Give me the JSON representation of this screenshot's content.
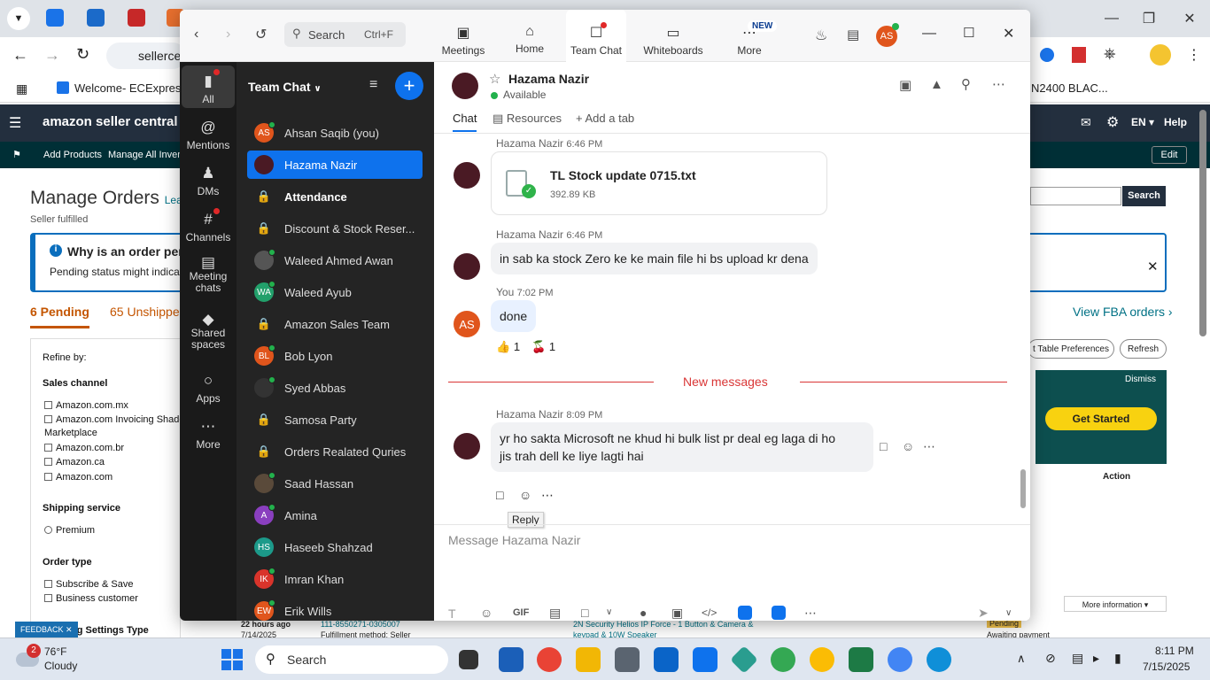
{
  "browser": {
    "address": "sellerce",
    "bookmark_welcome": "Welcome- ECExpres...",
    "bookmark_right": "N2400 BLAC..."
  },
  "amazon": {
    "brand": "amazon seller central",
    "lang": "EN",
    "help": "Help",
    "edit": "Edit",
    "add_products": "Add Products",
    "manage_inventory": "Manage All Invent",
    "page_title": "Manage Orders",
    "learn": "Lear",
    "subtitle": "Seller fulfilled",
    "info_title": "Why is an order pen",
    "info_body": "Pending status might indicate a",
    "tab_pending": "6 Pending",
    "tab_unshipped": "65 Unshipped",
    "search_btn": "Search",
    "view_fba": "View FBA orders",
    "table_prefs": "t Table Preferences",
    "refresh": "Refresh",
    "refine_by": "Refine by:",
    "sales_channel": "Sales channel",
    "channels": [
      "Amazon.com.mx",
      "Amazon.com Invoicing Shado",
      "Marketplace",
      "Amazon.com.br",
      "Amazon.ca",
      "Amazon.com"
    ],
    "shipping_service": "Shipping service",
    "premium": "Premium",
    "order_type": "Order type",
    "order_types": [
      "Subscribe & Save",
      "Business customer"
    ],
    "settings_type": "ng Settings Type",
    "feedback": "FEEDBACK",
    "dismiss": "Dismiss",
    "get_started": "Get Started",
    "action": "Action",
    "more_info": "More information",
    "row_time": "22 hours ago",
    "row_date": "7/14/2025",
    "row_order": "111-8550271-0305007",
    "row_fulfill": "Fulfillment method: Seller",
    "row_product": "2N Security Helios IP Force - 1 Button & Camera &",
    "row_product2": "keypad & 10W Speaker",
    "row_status": "Pending",
    "row_status2": "Awaiting payment"
  },
  "zoom": {
    "search_label": "Search",
    "search_shortcut": "Ctrl+F",
    "nav_tabs": [
      {
        "label": "Meetings"
      },
      {
        "label": "Home"
      },
      {
        "label": "Team Chat"
      },
      {
        "label": "Whiteboards"
      },
      {
        "label": "More"
      }
    ],
    "new_badge": "NEW",
    "user_initials": "AS",
    "rail": [
      {
        "label": "All"
      },
      {
        "label": "Mentions"
      },
      {
        "label": "DMs"
      },
      {
        "label": "Channels"
      },
      {
        "label": "Meeting chats"
      },
      {
        "label": "Shared spaces"
      },
      {
        "label": "Apps"
      },
      {
        "label": "More"
      }
    ],
    "list_title": "Team Chat",
    "chats": [
      {
        "name": "Ahsan Saqib (you)",
        "initials": "AS"
      },
      {
        "name": "Hazama Nazir",
        "initials": ""
      },
      {
        "name": "Attendance",
        "initials": ""
      },
      {
        "name": "Discount & Stock Reser...",
        "initials": ""
      },
      {
        "name": "Waleed Ahmed Awan",
        "initials": ""
      },
      {
        "name": "Waleed Ayub",
        "initials": "WA"
      },
      {
        "name": "Amazon Sales Team",
        "initials": ""
      },
      {
        "name": "Bob Lyon",
        "initials": "BL"
      },
      {
        "name": "Syed Abbas",
        "initials": ""
      },
      {
        "name": "Samosa Party",
        "initials": ""
      },
      {
        "name": "Orders Realated Quries",
        "initials": ""
      },
      {
        "name": "Saad Hassan",
        "initials": ""
      },
      {
        "name": "Amina",
        "initials": "A"
      },
      {
        "name": "Haseeb Shahzad",
        "initials": "HS"
      },
      {
        "name": "Imran Khan",
        "initials": "IK"
      },
      {
        "name": "Erik Wills",
        "initials": "EW"
      }
    ],
    "contact_name": "Hazama Nazir",
    "contact_status": "Available",
    "tabs": [
      "Chat",
      "Resources",
      "Add a tab"
    ],
    "messages": {
      "m1_sender": "Hazama Nazir",
      "m1_time": "6:46 PM",
      "file_name": "TL Stock update 0715.txt",
      "file_size": "392.89 KB",
      "m2_sender": "Hazama Nazir",
      "m2_time": "6:46 PM",
      "m2_text": "in sab ka stock Zero ke ke main file  hi bs upload kr dena",
      "m3_sender": "You",
      "m3_time": "7:02 PM",
      "m3_initials": "AS",
      "m3_text": "done",
      "reaction1_count": "1",
      "reaction2_count": "1",
      "new_messages": "New messages",
      "m4_sender": "Hazama Nazir",
      "m4_time": "8:09 PM",
      "m4_text_line1": "yr ho sakta Microsoft ne khud hi bulk list pr deal eg laga di ho",
      "m4_text_line2": "jis trah dell ke liye lagti hai",
      "reply_tooltip": "Reply"
    },
    "composer_placeholder": "Message Hazama Nazir",
    "gif": "GIF"
  },
  "taskbar": {
    "weather_badge": "2",
    "temp": "76°F",
    "condition": "Cloudy",
    "search": "Search",
    "time": "8:11 PM",
    "date": "7/15/2025"
  },
  "colors": {
    "zoom_blue": "#0e72ed",
    "amazon_dark": "#232f3e",
    "new_msg_red": "#d93636",
    "online": "#22b14c"
  }
}
